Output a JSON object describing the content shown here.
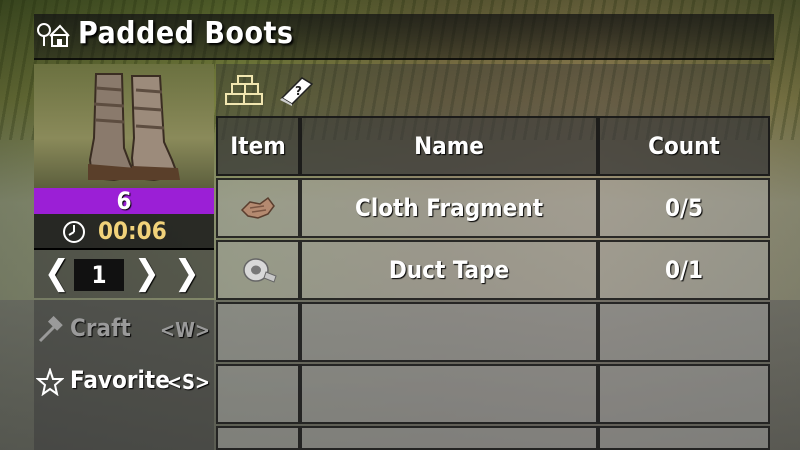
{
  "header": {
    "title": "Padded Boots"
  },
  "item": {
    "craft_count": "6",
    "craft_time": "00:06",
    "quantity": "1"
  },
  "quantity_controls": {
    "decrease_symbol": "❮",
    "increase_symbol": "❯",
    "max_symbol": "❯"
  },
  "actions": [
    {
      "label": "Craft",
      "key": "<W>",
      "enabled": false,
      "icon": "hammer-icon"
    },
    {
      "label": "Favorite",
      "key": "<S>",
      "enabled": true,
      "icon": "star-icon"
    }
  ],
  "tabs": [
    {
      "icon": "bricks-icon"
    },
    {
      "icon": "recipe-book-icon"
    }
  ],
  "ingredients_table": {
    "headers": [
      "Item",
      "Name",
      "Count"
    ],
    "rows": [
      {
        "icon": "cloth-fragment-icon",
        "name": "Cloth Fragment",
        "count": "0/5"
      },
      {
        "icon": "duct-tape-icon",
        "name": "Duct Tape",
        "count": "0/1"
      }
    ],
    "empty_rows": 3
  },
  "colors": {
    "craft_count_bar": "#9b1fd6",
    "timer_text": "#f1d27a",
    "disabled_text": "#9a9a9a",
    "enabled_text": "#ffffff"
  }
}
